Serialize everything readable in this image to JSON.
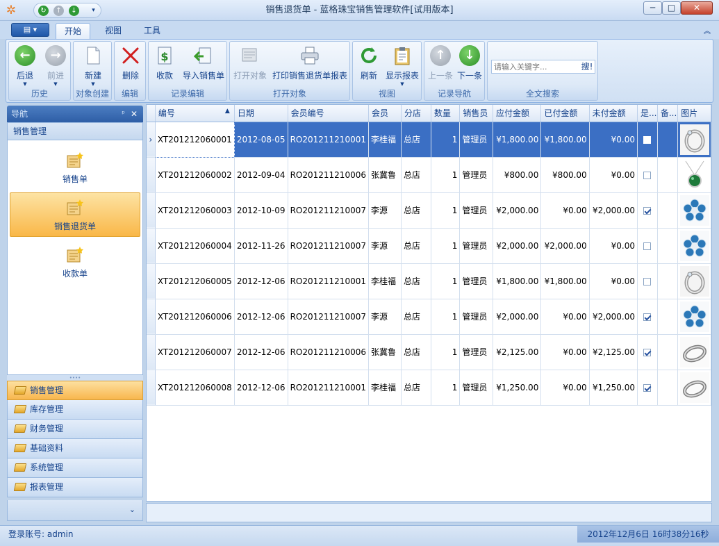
{
  "window": {
    "title": "销售退货单 - 蓝格珠宝销售管理软件[试用版本]",
    "minimize": "─",
    "maximize": "□",
    "close": "✕"
  },
  "ribbon_tabs": [
    {
      "label": "开始",
      "active": true
    },
    {
      "label": "视图",
      "active": false
    },
    {
      "label": "工具",
      "active": false
    }
  ],
  "ribbon_groups": {
    "history": {
      "label": "历史",
      "back": "后退",
      "forward": "前进"
    },
    "create": {
      "label": "对象创建",
      "new": "新建"
    },
    "edit": {
      "label": "编辑",
      "delete": "删除"
    },
    "record_edit": {
      "label": "记录编辑",
      "receive": "收款",
      "import": "导入销售单"
    },
    "open": {
      "label": "打开对象",
      "open_object": "打开对象",
      "print": "打印销售退货单报表"
    },
    "view": {
      "label": "视图",
      "refresh": "刷新",
      "show_report": "显示报表"
    },
    "nav": {
      "label": "记录导航",
      "prev": "上一条",
      "next": "下一条"
    },
    "search": {
      "label": "全文搜索",
      "placeholder": "请输入关键字...",
      "button": "搜!"
    }
  },
  "nav": {
    "header": "导航",
    "group_title": "销售管理",
    "items": [
      {
        "label": "销售单",
        "active": false
      },
      {
        "label": "销售退货单",
        "active": true
      },
      {
        "label": "收款单",
        "active": false
      }
    ],
    "modules": [
      {
        "label": "销售管理",
        "active": true
      },
      {
        "label": "库存管理",
        "active": false
      },
      {
        "label": "财务管理",
        "active": false
      },
      {
        "label": "基础资料",
        "active": false
      },
      {
        "label": "系统管理",
        "active": false
      },
      {
        "label": "报表管理",
        "active": false
      }
    ]
  },
  "table": {
    "columns": [
      "编号",
      "日期",
      "会员编号",
      "会员",
      "分店",
      "数量",
      "销售员",
      "应付金额",
      "已付金额",
      "未付金额",
      "是...",
      "备...",
      "图片"
    ],
    "rows": [
      {
        "id": "XT201212060001",
        "date": "2012-08-05",
        "member_id": "RO201211210001",
        "member": "李桂福",
        "store": "总店",
        "qty": "1",
        "sales": "管理员",
        "due": "¥1,800.00",
        "paid": "¥1,800.00",
        "unpaid": "¥0.00",
        "flag": false,
        "note": "",
        "image": "ring"
      },
      {
        "id": "XT201212060002",
        "date": "2012-09-04",
        "member_id": "RO201211210006",
        "member": "张冀鲁",
        "store": "总店",
        "qty": "1",
        "sales": "管理员",
        "due": "¥800.00",
        "paid": "¥800.00",
        "unpaid": "¥0.00",
        "flag": false,
        "note": "",
        "image": "pendant"
      },
      {
        "id": "XT201212060003",
        "date": "2012-10-09",
        "member_id": "RO201211210007",
        "member": "李源",
        "store": "总店",
        "qty": "1",
        "sales": "管理员",
        "due": "¥2,000.00",
        "paid": "¥0.00",
        "unpaid": "¥2,000.00",
        "flag": true,
        "note": "",
        "image": "flower"
      },
      {
        "id": "XT201212060004",
        "date": "2012-11-26",
        "member_id": "RO201211210007",
        "member": "李源",
        "store": "总店",
        "qty": "1",
        "sales": "管理员",
        "due": "¥2,000.00",
        "paid": "¥2,000.00",
        "unpaid": "¥0.00",
        "flag": false,
        "note": "",
        "image": "flower"
      },
      {
        "id": "XT201212060005",
        "date": "2012-12-06",
        "member_id": "RO201211210001",
        "member": "李桂福",
        "store": "总店",
        "qty": "1",
        "sales": "管理员",
        "due": "¥1,800.00",
        "paid": "¥1,800.00",
        "unpaid": "¥0.00",
        "flag": false,
        "note": "",
        "image": "ring"
      },
      {
        "id": "XT201212060006",
        "date": "2012-12-06",
        "member_id": "RO201211210007",
        "member": "李源",
        "store": "总店",
        "qty": "1",
        "sales": "管理员",
        "due": "¥2,000.00",
        "paid": "¥0.00",
        "unpaid": "¥2,000.00",
        "flag": true,
        "note": "",
        "image": "flower"
      },
      {
        "id": "XT201212060007",
        "date": "2012-12-06",
        "member_id": "RO201211210006",
        "member": "张冀鲁",
        "store": "总店",
        "qty": "1",
        "sales": "管理员",
        "due": "¥2,125.00",
        "paid": "¥0.00",
        "unpaid": "¥2,125.00",
        "flag": true,
        "note": "",
        "image": "band"
      },
      {
        "id": "XT201212060008",
        "date": "2012-12-06",
        "member_id": "RO201211210001",
        "member": "李桂福",
        "store": "总店",
        "qty": "1",
        "sales": "管理员",
        "due": "¥1,250.00",
        "paid": "¥0.00",
        "unpaid": "¥1,250.00",
        "flag": true,
        "note": "",
        "image": "band"
      }
    ],
    "selected_row": 0
  },
  "status": {
    "login": "登录账号: admin",
    "datetime": "2012年12月6日 16时38分16秒"
  },
  "colors": {
    "selection": "#3b6fc4",
    "ribbon_text": "#15428b",
    "nav_active": "#f9b748"
  }
}
